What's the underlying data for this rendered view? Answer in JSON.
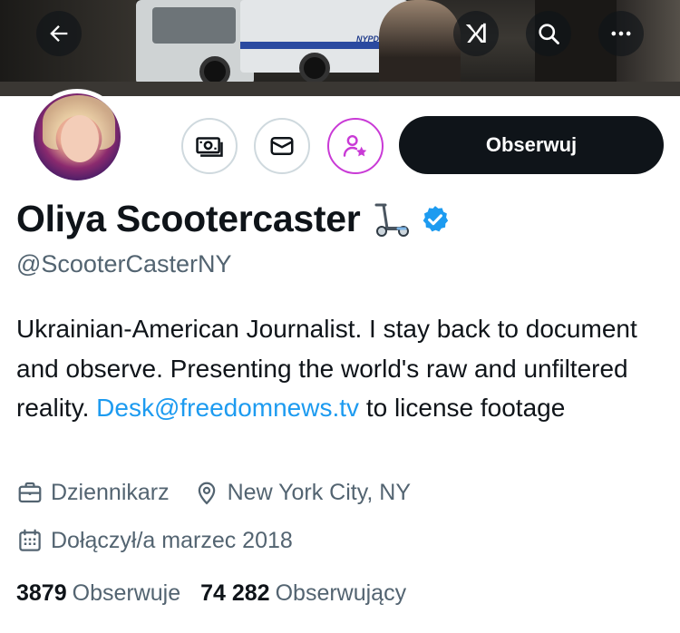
{
  "header": {
    "back_icon": "arrow-left-icon",
    "grok_icon": "grok-logo-icon",
    "search_icon": "search-icon",
    "more_icon": "more-horizontal-icon",
    "banner_van_text": "NYPD"
  },
  "actions": {
    "subscribe_icon": "money-icon",
    "message_icon": "envelope-icon",
    "follow_notifications_icon": "person-star-icon",
    "follow_label": "Obserwuj"
  },
  "profile": {
    "name": "Oliya Scootercaster",
    "name_emoji": "🛴",
    "verified": true,
    "handle": "@ScooterCasterNY",
    "bio_text": "Ukrainian-American Journalist. I stay back to document and observe. Presenting the world's raw and unfiltered reality.",
    "bio_link": "Desk@freedomnews.tv",
    "bio_after_link": "to license footage",
    "profession": "Dziennikarz",
    "location": "New York City, NY",
    "joined": "Dołączył/a marzec 2018"
  },
  "stats": {
    "following_count": "3879",
    "following_label": "Obserwuje",
    "followers_count": "74 282",
    "followers_label": "Obserwujący"
  },
  "colors": {
    "accent": "#1d9bf0",
    "verified": "#1d9bf0",
    "text": "#0f1419",
    "secondary": "#536471",
    "purple": "#c93ad6"
  }
}
